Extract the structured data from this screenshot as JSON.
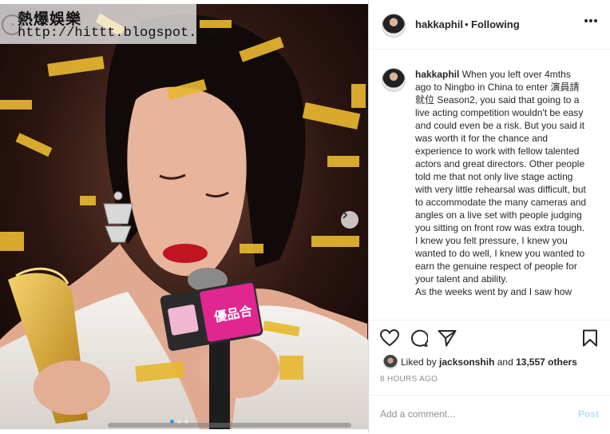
{
  "watermark": {
    "title": "熱爆娛樂",
    "url": "http://hittt.blogspot.com"
  },
  "carousel": {
    "slide_count": 3,
    "active_slide": 1
  },
  "trophy_sign": {
    "text": "優品合"
  },
  "post": {
    "username": "hakkaphil",
    "separator": "•",
    "follow_status": "Following",
    "caption_paragraphs": [
      "When you left over 4mths ago to Ningbo in China to enter 演員請就位 Season2, you said that going to a live acting competition wouldn't be easy and could even be a risk. But you said it was worth it for the chance and experience to work with fellow talented actors and great directors. Other people told me that not only live stage acting with very little rehearsal was difficult, but to accommodate the many cameras and angles on a live set with people judging you sitting on front row was extra tough.",
      "I knew you felt pressure, I knew you wanted to do well, I knew you wanted to earn the genuine respect of people for your talent and ability.",
      "As the weeks went by and I saw how"
    ],
    "likes": {
      "prefix": "Liked by",
      "user": "jacksonshih",
      "joiner": "and",
      "others": "13,557 others"
    },
    "timestamp": "8 HOURS AGO",
    "comment_placeholder": "Add a comment...",
    "post_button": "Post"
  },
  "colors": {
    "accent": "#3897f0",
    "post_disabled": "#b2dffc",
    "muted": "#8e8e8e",
    "confetti": "#e8b830",
    "lipstick": "#c0141f",
    "mic_sign": "#e0268f"
  },
  "icons": [
    "heart-icon",
    "comment-icon",
    "share-icon",
    "bookmark-icon",
    "more-options-icon",
    "next-slide-icon"
  ]
}
